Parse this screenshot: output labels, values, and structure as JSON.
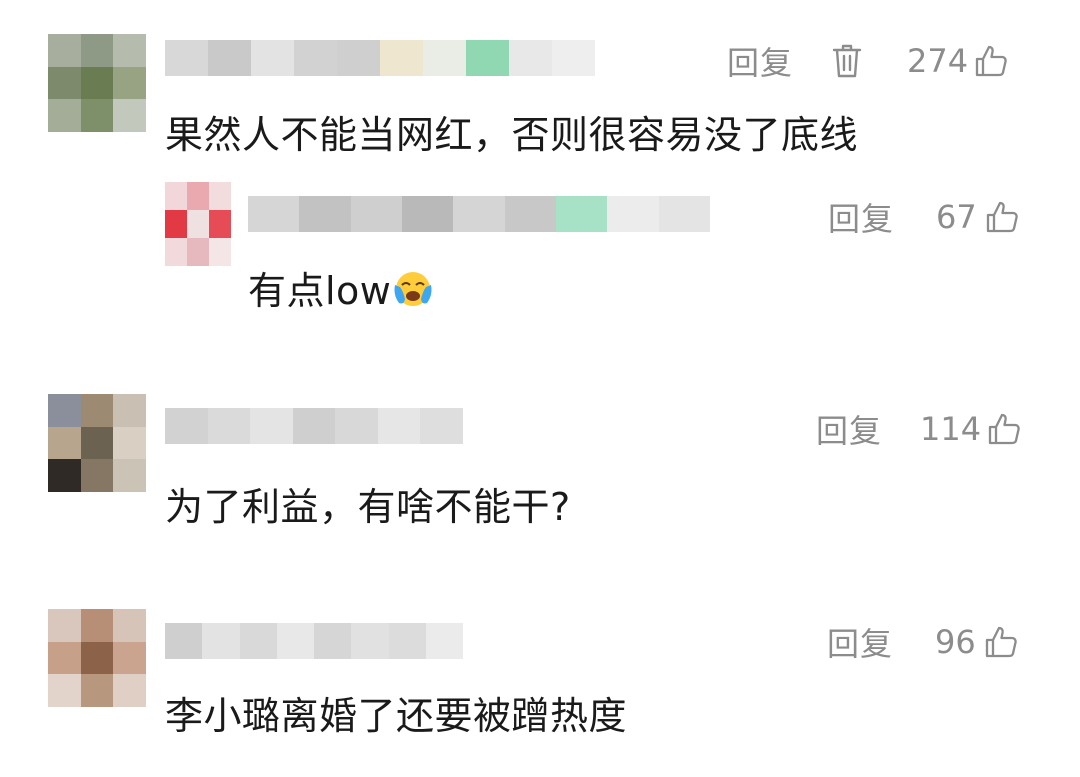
{
  "comments": [
    {
      "reply_label": "回复",
      "likes": "274",
      "text": "果然人不能当网红，否则很容易没了底线",
      "has_delete": true,
      "avatar_colors": [
        "#a7ae9e",
        "#8f9a86",
        "#b5bcae",
        "#7d8b6c",
        "#6a7d52",
        "#97a382",
        "#a3ad98",
        "#7e9069",
        "#c3c8bc"
      ],
      "name_colors": [
        "#d8d8d8",
        "#c9c9c9",
        "#e3e3e3",
        "#d2d2d2",
        "#cfcfcf",
        "#efe6cf",
        "#e9ede6",
        "#8fd8b2",
        "#e8e8e8",
        "#eeeeee"
      ],
      "replies": [
        {
          "reply_label": "回复",
          "likes": "67",
          "text": "有点low",
          "emoji": "😭",
          "avatar_colors": [
            "#f1d7d9",
            "#e9a9ae",
            "#f3dcde",
            "#e23a44",
            "#efe1e2",
            "#e64c55",
            "#f2d9db",
            "#e5b9bd",
            "#f4e6e7"
          ],
          "name_colors": [
            "#d6d6d6",
            "#c2c2c2",
            "#cfcfcf",
            "#b9b9b9",
            "#d5d5d5",
            "#c8c8c8",
            "#a7e2c6",
            "#ececec",
            "#e4e4e4"
          ]
        }
      ]
    },
    {
      "reply_label": "回复",
      "likes": "114",
      "text": "为了利益，有啥不能干?",
      "has_delete": false,
      "avatar_colors": [
        "#8a8f9b",
        "#9c8a73",
        "#c9c0b3",
        "#b7a58e",
        "#6c6252",
        "#d9d0c3",
        "#2f2a25",
        "#857764",
        "#cbc3b6"
      ],
      "name_colors": [
        "#d2d2d2",
        "#dadada",
        "#e4e4e4",
        "#cfcfcf",
        "#d8d8d8",
        "#e6e6e6",
        "#dedede"
      ]
    },
    {
      "reply_label": "回复",
      "likes": "96",
      "text": "李小璐离婚了还要被蹭热度",
      "has_delete": false,
      "avatar_colors": [
        "#d9c6bc",
        "#b78f77",
        "#d7c4b9",
        "#c7a089",
        "#8c6348",
        "#caa48f",
        "#e2d3cb",
        "#b8977f",
        "#dfcfc5"
      ],
      "name_colors": [
        "#cfcfcf",
        "#e3e3e3",
        "#d9d9d9",
        "#e8e8e8",
        "#d6d6d6",
        "#e1e1e1",
        "#dcdcdc",
        "#ebebeb"
      ]
    }
  ]
}
